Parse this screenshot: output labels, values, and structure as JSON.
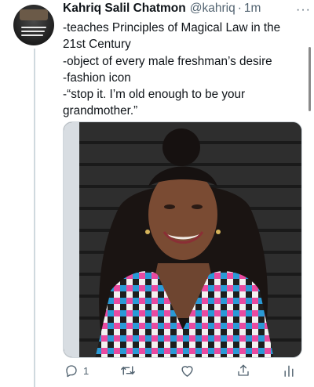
{
  "tweet": {
    "author_name": "Kahriq Salil Chatmon",
    "handle": "@kahriq",
    "separator": "·",
    "time": "1m",
    "lines": [
      "-teaches Principles of Magical Law in the",
      "21st Century",
      "-object of every male freshman’s desire",
      "-fashion icon",
      "-“stop it. I’m old enough to be your",
      "grandmother.”"
    ],
    "more_icon": "ellipsis-icon",
    "avatar_text": [
      "WHEN THIS WORLD IS TRULY",
      "STILL WRITTEN BY HER",
      "AND THAT ENDS"
    ]
  },
  "actions": {
    "reply_count": "1",
    "retweet_count": "",
    "like_count": ""
  },
  "colors": {
    "text_primary": "#0f1419",
    "text_secondary": "#536471",
    "thread_line": "#cfd9de"
  }
}
